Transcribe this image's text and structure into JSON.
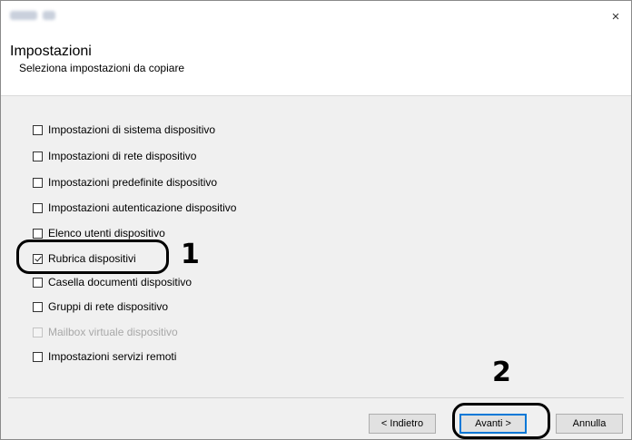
{
  "window": {
    "title": "",
    "close_symbol": "×"
  },
  "header": {
    "title": "Impostazioni",
    "subtitle": "Seleziona impostazioni da copiare"
  },
  "options": [
    {
      "label": "Impostazioni di sistema dispositivo",
      "checked": false,
      "enabled": true
    },
    {
      "label": "Impostazioni di rete dispositivo",
      "checked": false,
      "enabled": true
    },
    {
      "label": "Impostazioni predefinite dispositivo",
      "checked": false,
      "enabled": true
    },
    {
      "label": "Impostazioni autenticazione dispositivo",
      "checked": false,
      "enabled": true
    },
    {
      "label": "Elenco utenti dispositivo",
      "checked": false,
      "enabled": true
    },
    {
      "label": "Rubrica dispositivi",
      "checked": true,
      "enabled": true
    },
    {
      "label": "Casella documenti dispositivo",
      "checked": false,
      "enabled": true
    },
    {
      "label": "Gruppi di rete dispositivo",
      "checked": false,
      "enabled": true
    },
    {
      "label": "Mailbox virtuale dispositivo",
      "checked": false,
      "enabled": false
    },
    {
      "label": "Impostazioni servizi remoti",
      "checked": false,
      "enabled": true
    }
  ],
  "buttons": {
    "back": "< Indietro",
    "next": "Avanti >",
    "cancel": "Annulla"
  },
  "callouts": {
    "one": "1",
    "two": "2"
  },
  "colors": {
    "accent": "#0078d7",
    "dialog_bg": "#f0f0f0",
    "header_bg": "#ffffff"
  }
}
